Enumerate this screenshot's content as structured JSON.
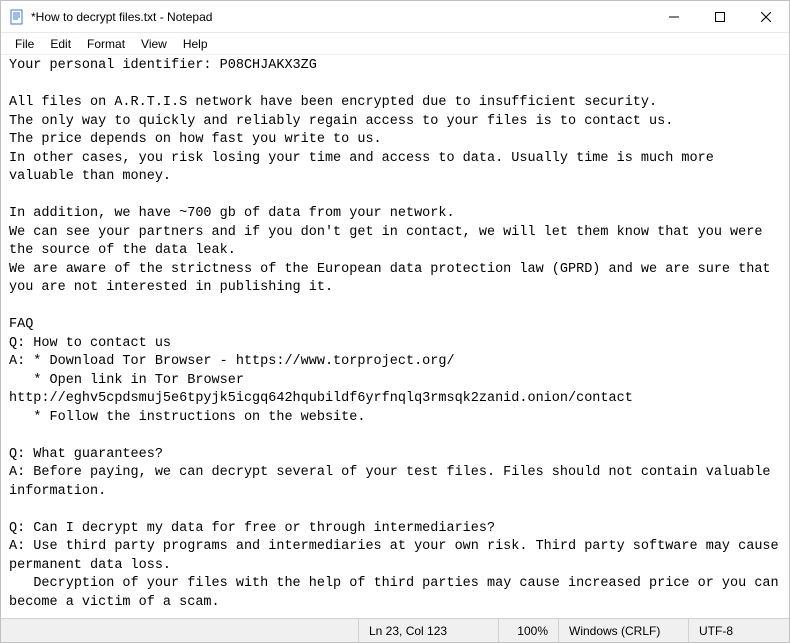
{
  "window": {
    "title": "*How to decrypt files.txt - Notepad"
  },
  "menu": {
    "file": "File",
    "edit": "Edit",
    "format": "Format",
    "view": "View",
    "help": "Help"
  },
  "content": {
    "text": "Your personal identifier: P08CHJAKX3ZG\n\nAll files on A.R.T.I.S network have been encrypted due to insufficient security.\nThe only way to quickly and reliably regain access to your files is to contact us.\nThe price depends on how fast you write to us.\nIn other cases, you risk losing your time and access to data. Usually time is much more valuable than money.\n\nIn addition, we have ~700 gb of data from your network.\nWe can see your partners and if you don't get in contact, we will let them know that you were the source of the data leak.\nWe are aware of the strictness of the European data protection law (GPRD) and we are sure that you are not interested in publishing it.\n\nFAQ\nQ: How to contact us\nA: * Download Tor Browser - https://www.torproject.org/\n   * Open link in Tor Browser http://eghv5cpdsmuj5e6tpyjk5icgq642hqubildf6yrfnqlq3rmsqk2zanid.onion/contact\n   * Follow the instructions on the website.\n\nQ: What guarantees?\nA: Before paying, we can decrypt several of your test files. Files should not contain valuable information.\n\nQ: Can I decrypt my data for free or through intermediaries?\nA: Use third party programs and intermediaries at your own risk. Third party software may cause permanent data loss.\n   Decryption of your files with the help of third parties may cause increased price or you can become a victim of a scam."
  },
  "status": {
    "cursor": "Ln 23, Col 123",
    "zoom": "100%",
    "lineEnding": "Windows (CRLF)",
    "encoding": "UTF-8"
  }
}
